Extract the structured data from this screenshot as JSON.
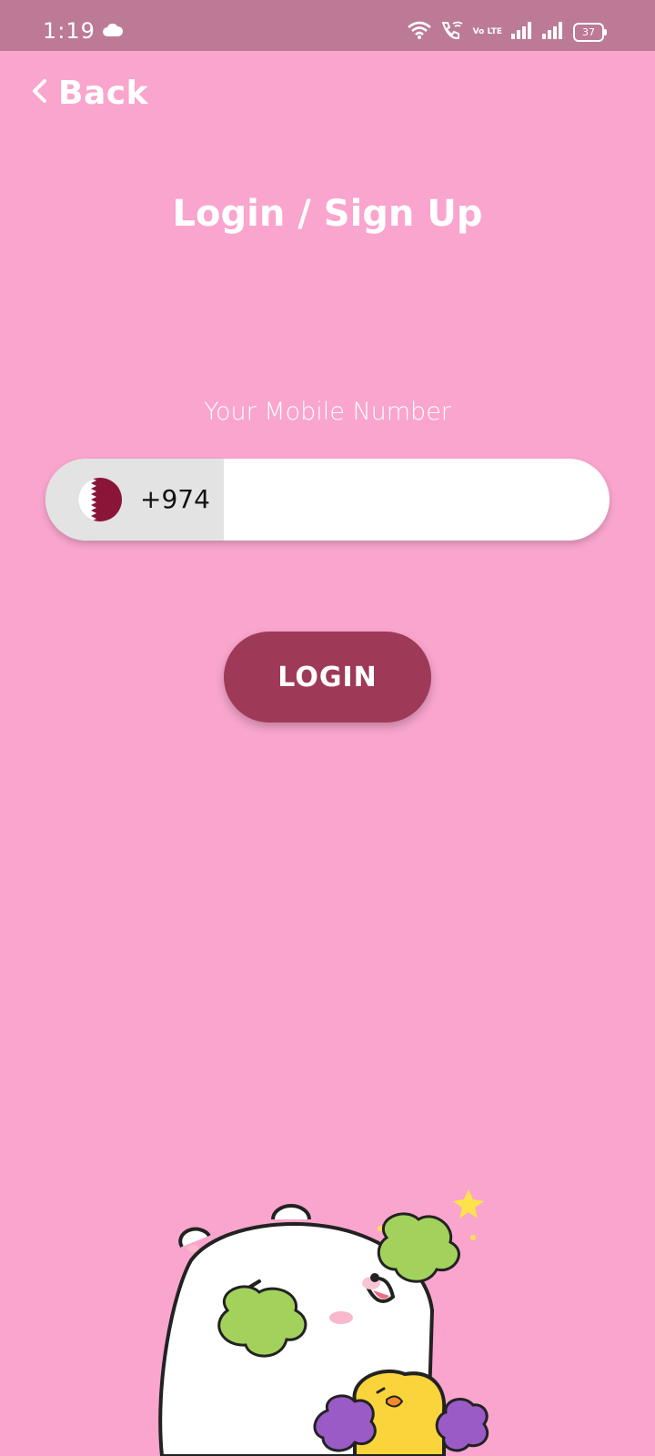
{
  "status_bar": {
    "time": "1:19",
    "battery": "37",
    "network_label": "Vo LTE",
    "icons": [
      "cloud-icon",
      "wifi-icon",
      "wifi-calling-icon",
      "volte-icon",
      "signal-icon",
      "signal-icon",
      "battery-icon"
    ]
  },
  "header": {
    "back_label": "Back"
  },
  "page": {
    "title": "Login / Sign Up"
  },
  "phone": {
    "label": "Your Mobile Number",
    "country_code": "+974",
    "country_flag": "qatar-flag",
    "value": "",
    "placeholder": ""
  },
  "actions": {
    "login_label": "LOGIN"
  },
  "colors": {
    "background": "#f9a5cd",
    "status_bar": "#bc7a96",
    "button": "#9e3a57",
    "flag_maroon": "#8a1538"
  }
}
